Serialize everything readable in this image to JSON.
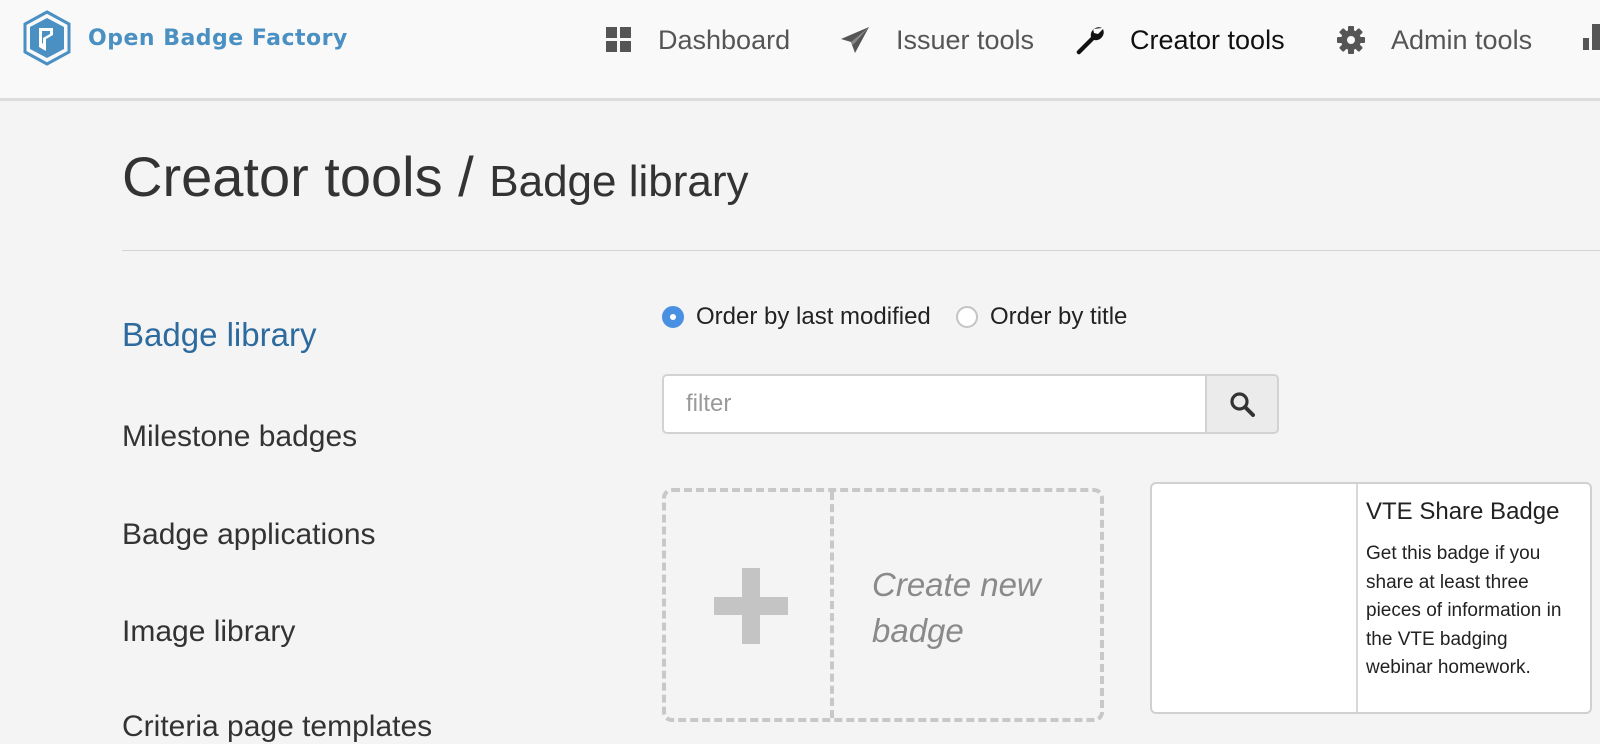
{
  "brand": {
    "name": "Open Badge Factory"
  },
  "nav": {
    "items": [
      {
        "label": "Dashboard",
        "icon": "dashboard-grid-icon"
      },
      {
        "label": "Issuer tools",
        "icon": "paper-plane-icon"
      },
      {
        "label": "Creator tools",
        "icon": "wrench-icon",
        "active": true
      },
      {
        "label": "Admin tools",
        "icon": "gear-icon"
      }
    ]
  },
  "page": {
    "title": "Creator tools",
    "separator": "/",
    "subtitle": "Badge library"
  },
  "sidebar": {
    "items": [
      {
        "label": "Badge library",
        "active": true
      },
      {
        "label": "Milestone badges"
      },
      {
        "label": "Badge applications"
      },
      {
        "label": "Image library"
      },
      {
        "label": "Criteria page templates"
      }
    ]
  },
  "order": {
    "options": [
      {
        "label": "Order by last modified",
        "checked": true
      },
      {
        "label": "Order by title",
        "checked": false
      }
    ]
  },
  "filter": {
    "placeholder": "filter",
    "value": ""
  },
  "create": {
    "label": "Create new badge"
  },
  "badges": [
    {
      "title": "VTE Share Badge",
      "description": "Get this badge if you share at least three pieces of information in the VTE badging webinar homework."
    }
  ],
  "colors": {
    "brand": "#4a90c2",
    "link_active": "#2d6b9e",
    "radio_checked": "#4a90e2"
  }
}
